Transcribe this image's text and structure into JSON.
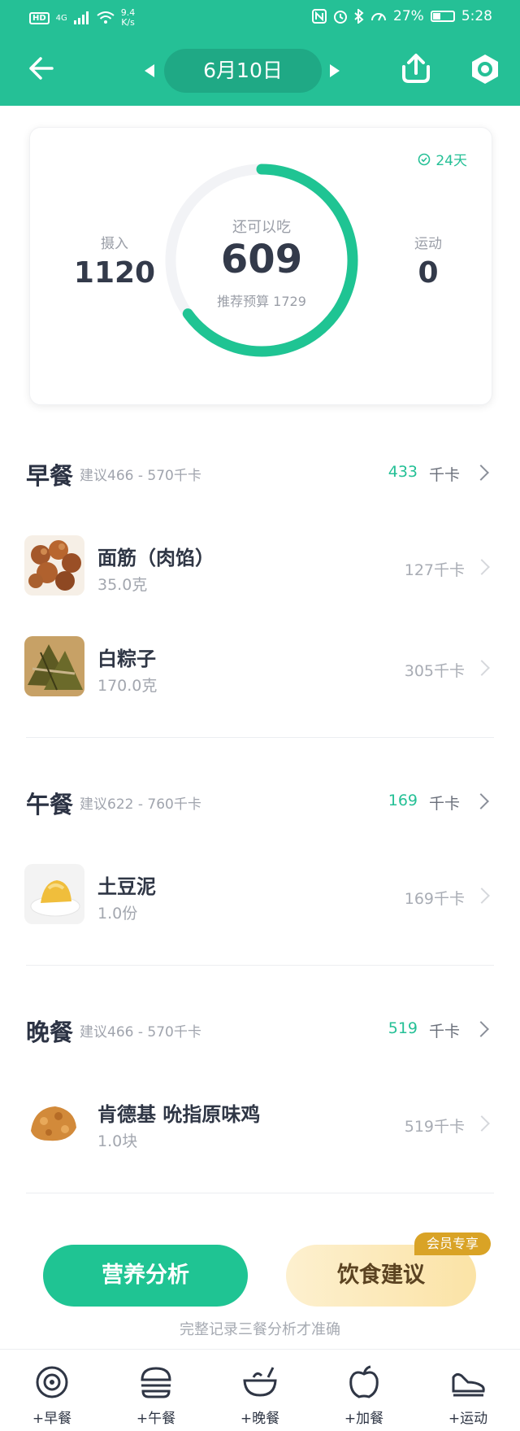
{
  "status_bar": {
    "network": "HD",
    "signal": "4G",
    "speed_value": "9.4",
    "speed_unit": "K/s",
    "battery": "27%",
    "time": "5:28"
  },
  "header": {
    "date": "6月10日",
    "icons": [
      "back-arrow-icon",
      "prev-day-icon",
      "next-day-icon",
      "upload-icon",
      "settings-icon"
    ]
  },
  "summary": {
    "streak": "24天",
    "intake_label": "摄入",
    "intake_value": "1120",
    "remaining_label": "还可以吃",
    "remaining_value": "609",
    "budget_text": "推荐预算 1729",
    "exercise_label": "运动",
    "exercise_value": "0",
    "ring_fraction": 0.65,
    "ring_color": "#1fc493",
    "track_color": "#f2f3f6"
  },
  "meals": {
    "breakfast": {
      "title": "早餐",
      "suggestion": "建议466 - 570千卡",
      "kcal": "433",
      "unit": "千卡",
      "items": [
        {
          "name": "面筋（肉馅）",
          "amount": "35.0克",
          "kcal": "127千卡"
        },
        {
          "name": "白粽子",
          "amount": "170.0克",
          "kcal": "305千卡"
        }
      ]
    },
    "lunch": {
      "title": "午餐",
      "suggestion": "建议622 - 760千卡",
      "kcal": "169",
      "unit": "千卡",
      "items": [
        {
          "name": "土豆泥",
          "amount": "1.0份",
          "kcal": "169千卡"
        }
      ]
    },
    "dinner": {
      "title": "晚餐",
      "suggestion": "建议466 - 570千卡",
      "kcal": "519",
      "unit": "千卡",
      "items": [
        {
          "name": "肯德基 吮指原味鸡",
          "amount": "1.0块",
          "kcal": "519千卡"
        }
      ]
    }
  },
  "actions": {
    "nutrition_label": "营养分析",
    "diet_advice_label": "饮食建议",
    "vip_badge": "会员专享",
    "hint": "完整记录三餐分析才准确"
  },
  "bottom_nav": {
    "tabs": [
      {
        "label": "+早餐",
        "icon": "breakfast-icon"
      },
      {
        "label": "+午餐",
        "icon": "lunch-icon"
      },
      {
        "label": "+晚餐",
        "icon": "dinner-icon"
      },
      {
        "label": "+加餐",
        "icon": "snack-icon"
      },
      {
        "label": "+运动",
        "icon": "exercise-icon"
      }
    ]
  },
  "colors": {
    "brand": "#25c096",
    "accent_text": "#25c096",
    "vip": "#d9a326"
  }
}
